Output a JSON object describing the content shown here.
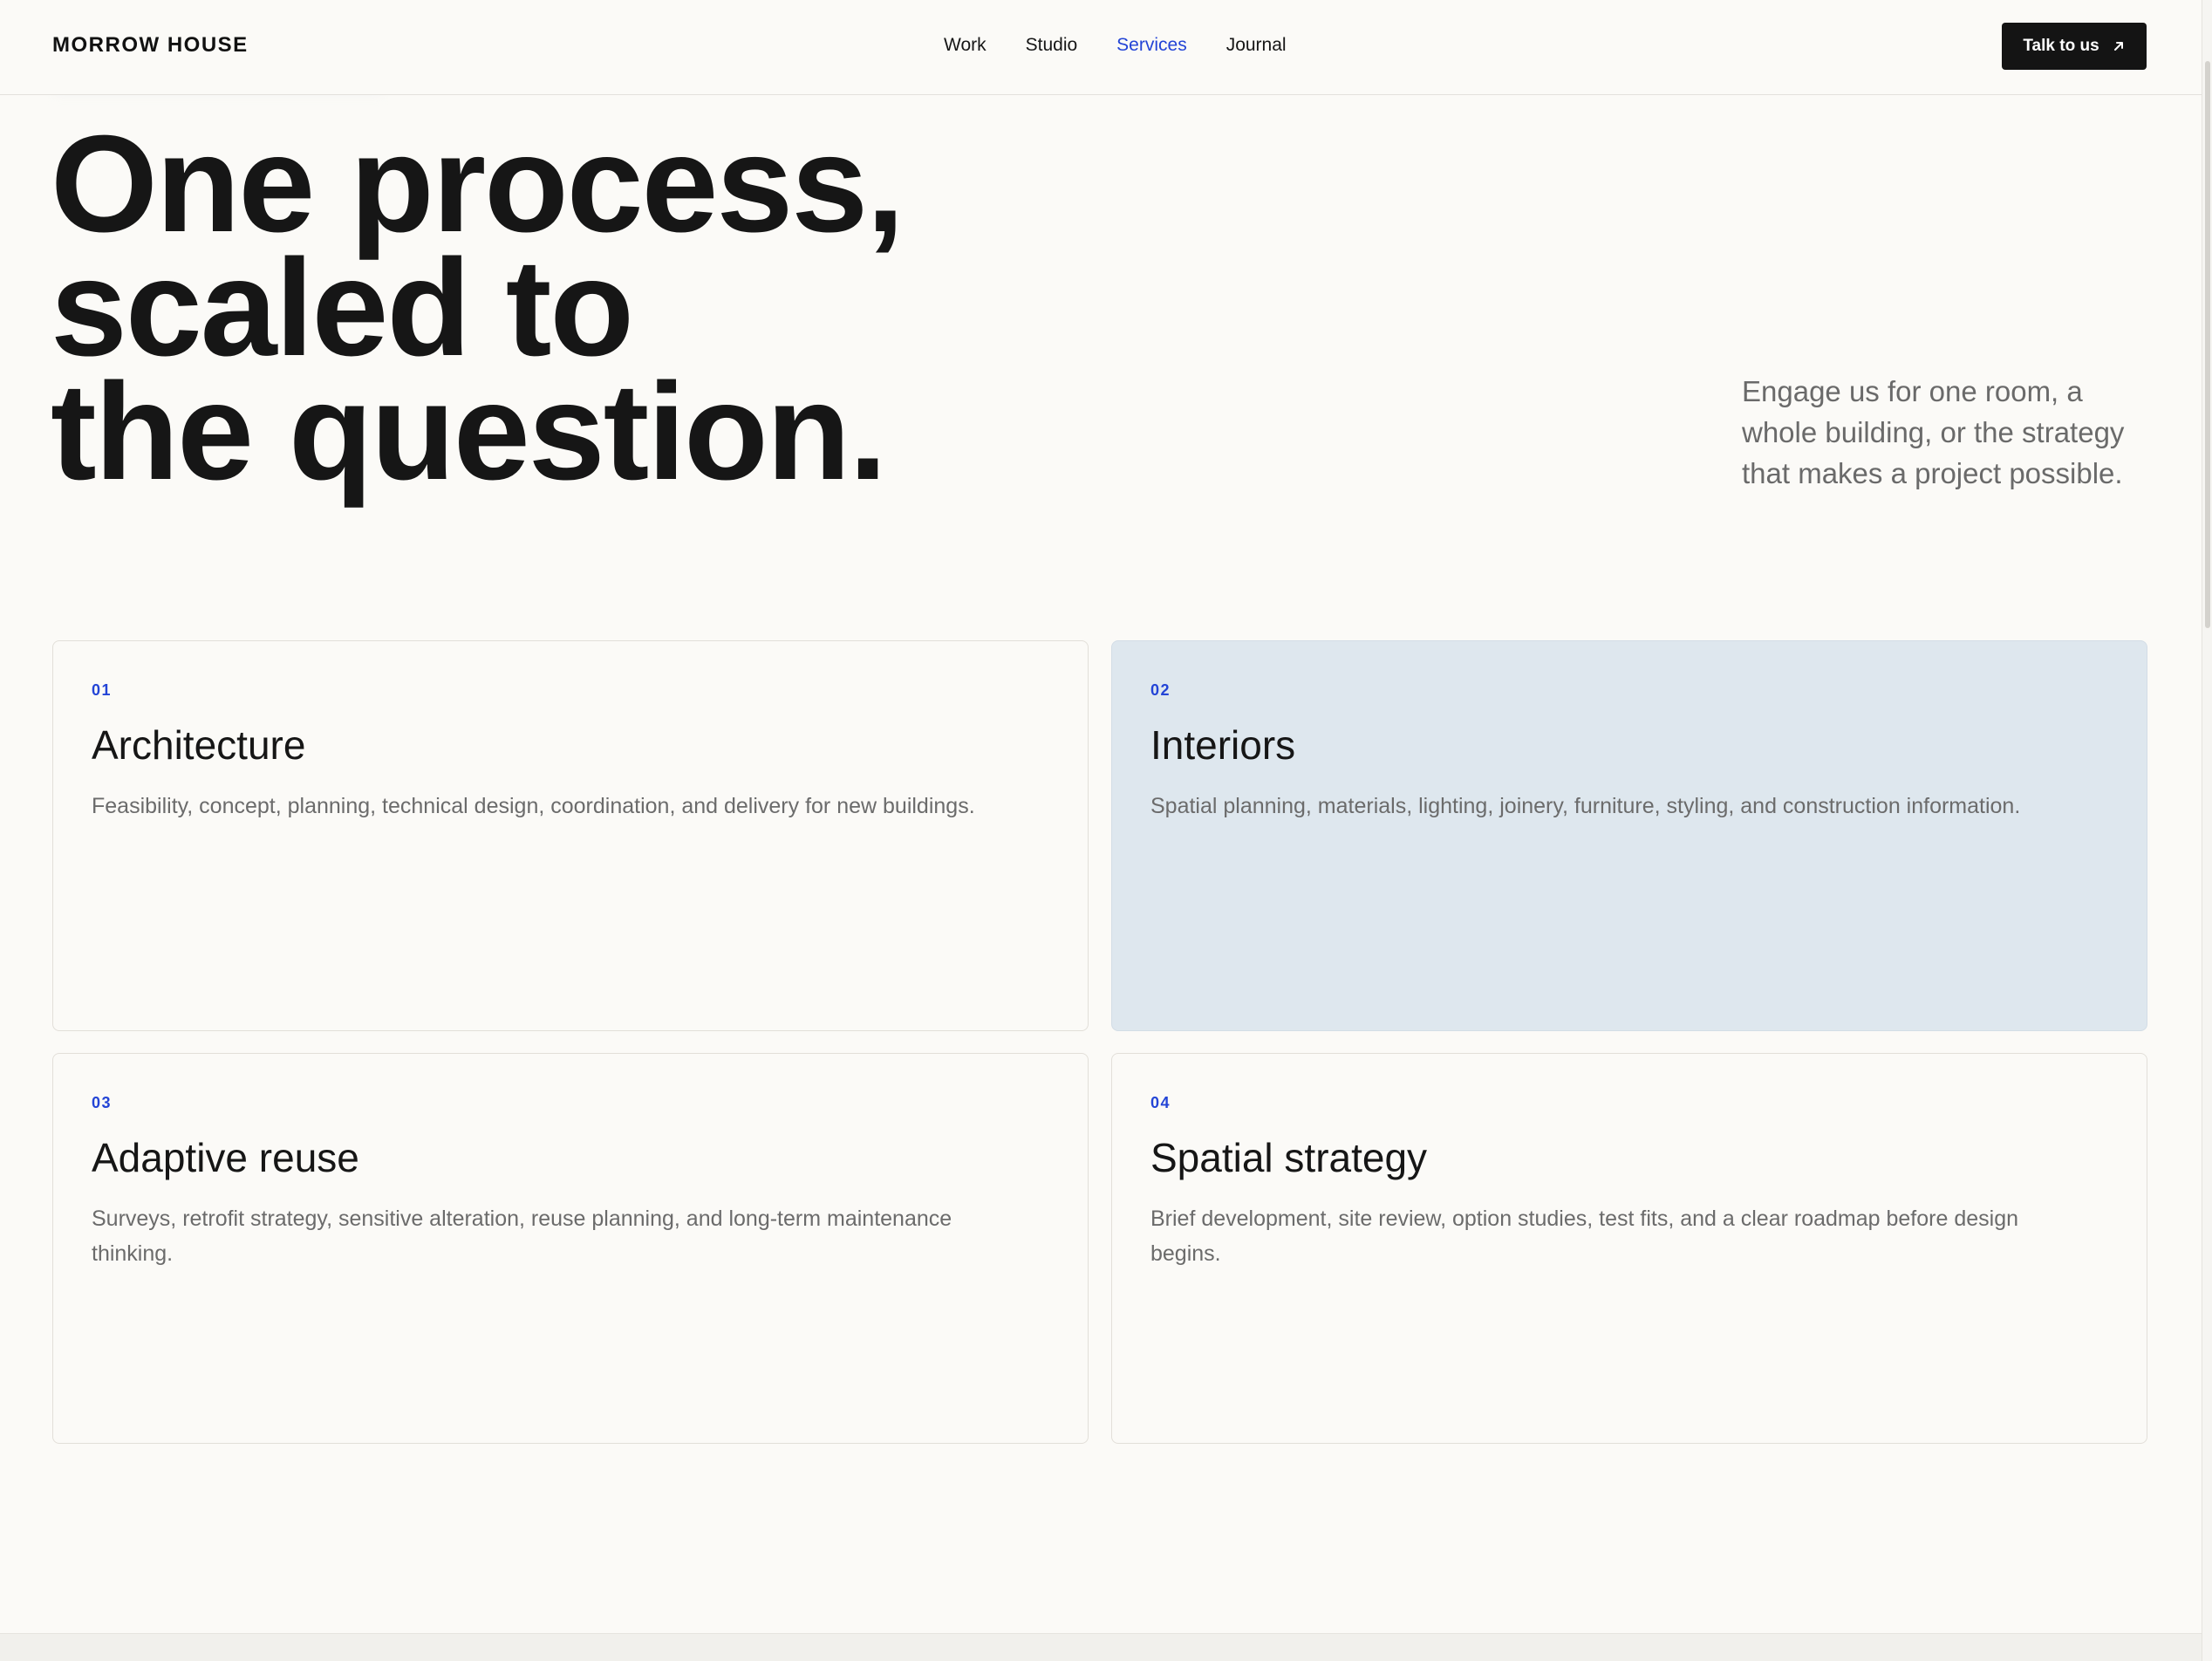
{
  "header": {
    "brand": "MORROW HOUSE",
    "nav": [
      {
        "label": "Work",
        "active": false
      },
      {
        "label": "Studio",
        "active": false
      },
      {
        "label": "Services",
        "active": true
      },
      {
        "label": "Journal",
        "active": false
      }
    ],
    "cta_label": "Talk to us",
    "cta_icon": "arrow-up-right-icon"
  },
  "hero": {
    "title_lines": [
      "One process,",
      "scaled to",
      "the question."
    ],
    "intro": "Engage us for one room, a whole building, or the strategy that makes a project possible."
  },
  "services": [
    {
      "number": "01",
      "title": "Architecture",
      "description": "Feasibility, concept, planning, technical design, coordination, and delivery for new buildings.",
      "highlighted": false
    },
    {
      "number": "02",
      "title": "Interiors",
      "description": "Spatial planning, materials, lighting, joinery, furniture, styling, and construction information.",
      "highlighted": true
    },
    {
      "number": "03",
      "title": "Adaptive reuse",
      "description": "Surveys, retrofit strategy, sensitive alteration, reuse planning, and long-term maintenance thinking.",
      "highlighted": false
    },
    {
      "number": "04",
      "title": "Spatial strategy",
      "description": "Brief development, site review, option studies, test fits, and a clear roadmap before design begins.",
      "highlighted": false
    }
  ],
  "colors": {
    "background": "#fbfaf7",
    "accent": "#2344d6",
    "text": "#161616",
    "muted": "#6b6b6b",
    "highlight_card": "#dee7ee",
    "cta_bg": "#141414"
  }
}
